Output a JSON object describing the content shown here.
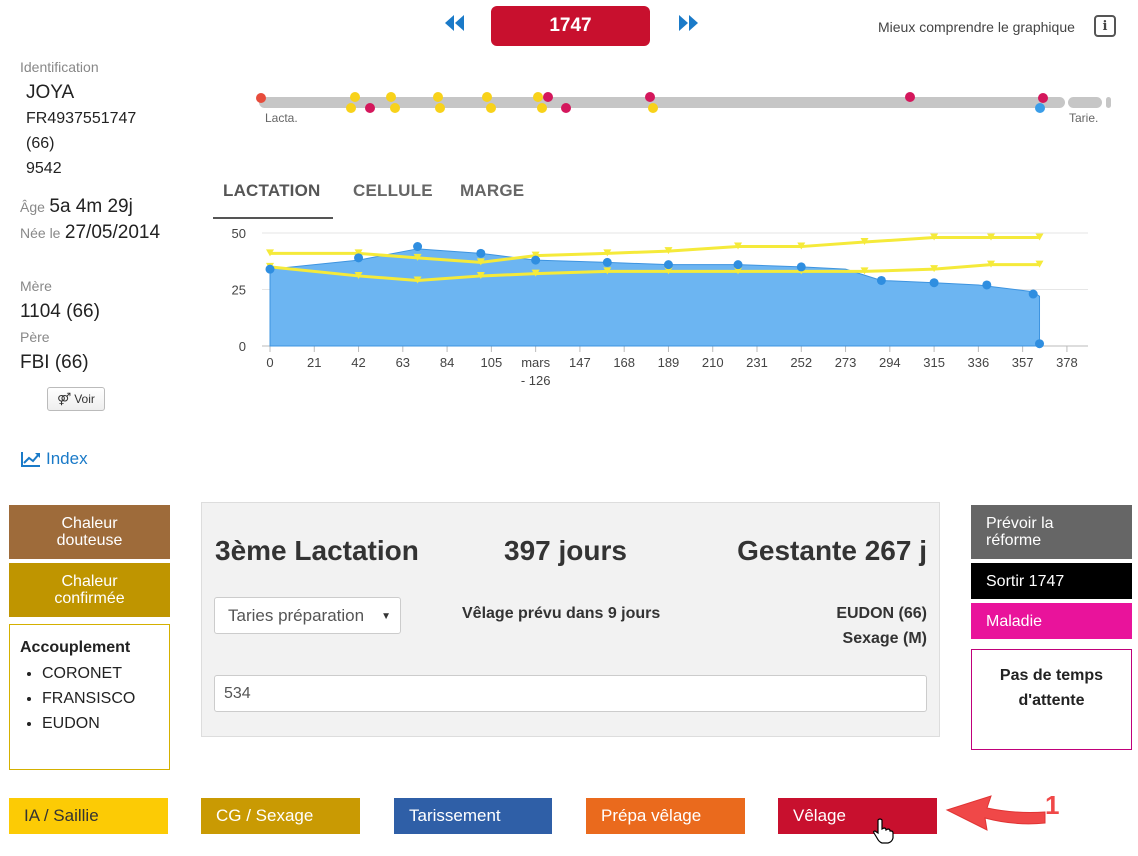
{
  "header": {
    "prev_label": "◀◀",
    "next_label": "▶▶",
    "animal_number": "1747",
    "help_link": "Mieux comprendre le graphique",
    "info_icon": "i"
  },
  "animal": {
    "identification_label": "Identification",
    "name": "JOYA",
    "national_id": "FR4937551747",
    "herd_code": "(66)",
    "work_number": "9542",
    "age_label": "Âge",
    "age_value": "5a 4m 29j",
    "born_label": "Née le",
    "born_value": "27/05/2014",
    "mother_label": "Mère",
    "mother_value": "1104 (66)",
    "father_label": "Père",
    "father_value": "FBI (66)",
    "voir_label": "Voir",
    "index_label": "Index"
  },
  "timeline": {
    "start_label": "Lacta.",
    "end_label": "Tarie."
  },
  "tabs": [
    {
      "label": "LACTATION",
      "active": true
    },
    {
      "label": "CELLULE",
      "active": false
    },
    {
      "label": "MARGE",
      "active": false
    }
  ],
  "chart_data": {
    "type": "area",
    "x_ticks": [
      "0",
      "21",
      "42",
      "63",
      "84",
      "105",
      "mars\n- 126",
      "147",
      "168",
      "189",
      "210",
      "231",
      "252",
      "273",
      "294",
      "315",
      "336",
      "357",
      "378"
    ],
    "y_ticks": [
      0,
      25,
      50
    ],
    "xlim": [
      0,
      388
    ],
    "ylim": [
      0,
      50
    ],
    "series": [
      {
        "type": "area",
        "color": "#4da3ee",
        "x": [
          0,
          42,
          70,
          100,
          126,
          160,
          189,
          222,
          252,
          273,
          290,
          315,
          336,
          362,
          365
        ],
        "y": [
          34,
          38,
          43,
          41,
          38,
          37,
          36,
          36,
          35,
          34,
          29,
          28,
          27,
          24,
          22
        ],
        "points_x": [
          0,
          42,
          70,
          100,
          126,
          160,
          189,
          222,
          252,
          290,
          315,
          340,
          362,
          365
        ],
        "points_y": [
          34,
          39,
          44,
          41,
          38,
          37,
          36,
          36,
          35,
          29,
          28,
          27,
          23,
          1
        ]
      },
      {
        "type": "line",
        "color": "#f5ea3a",
        "x": [
          0,
          42,
          70,
          100,
          126,
          160,
          189,
          222,
          252,
          282,
          315,
          342,
          365
        ],
        "y": [
          41,
          41,
          39,
          37,
          40,
          41,
          42,
          44,
          44,
          46,
          48,
          48,
          48
        ]
      },
      {
        "type": "line",
        "color": "#f5ea3a",
        "x": [
          0,
          42,
          70,
          100,
          126,
          160,
          189,
          222,
          252,
          282,
          315,
          342,
          365
        ],
        "y": [
          35,
          31,
          29,
          31,
          32,
          33,
          33,
          33,
          33,
          33,
          34,
          36,
          36
        ]
      }
    ]
  },
  "actions_left": {
    "chaleur_douteuse": "Chaleur douteuse",
    "chaleur_confirmee": "Chaleur confirmée",
    "accouplement_title": "Accouplement",
    "accouplement_items": [
      "CORONET",
      "FRANSISCO",
      "EUDON"
    ]
  },
  "panel": {
    "lactation": "3ème Lactation",
    "days": "397 jours",
    "gestante": "Gestante 267 j",
    "select_value": "Taries préparation",
    "velage_prevu": "Vêlage prévu dans 9 jours",
    "bull": "EUDON (66)",
    "sexage": "Sexage (M)",
    "input_value": "534"
  },
  "actions_right": {
    "prevoir_reforme": "Prévoir la réforme",
    "sortir": "Sortir 1747",
    "maladie": "Maladie",
    "pas_temps": "Pas de temps d'attente"
  },
  "bottom_buttons": {
    "ia": "IA / Saillie",
    "cg": "CG / Sexage",
    "tarissement": "Tarissement",
    "prepa": "Prépa vêlage",
    "velage": "Vêlage"
  },
  "annotation": {
    "number": "1"
  },
  "colors": {
    "red": "#c8102e",
    "brown": "#9e6b3a",
    "gold": "#bf9500",
    "yellow": "#fccb05",
    "mustard": "#c99a03",
    "blue": "#2f5fa7",
    "orange": "#ea6a1d",
    "gray": "#666666",
    "magenta": "#e9139b"
  }
}
